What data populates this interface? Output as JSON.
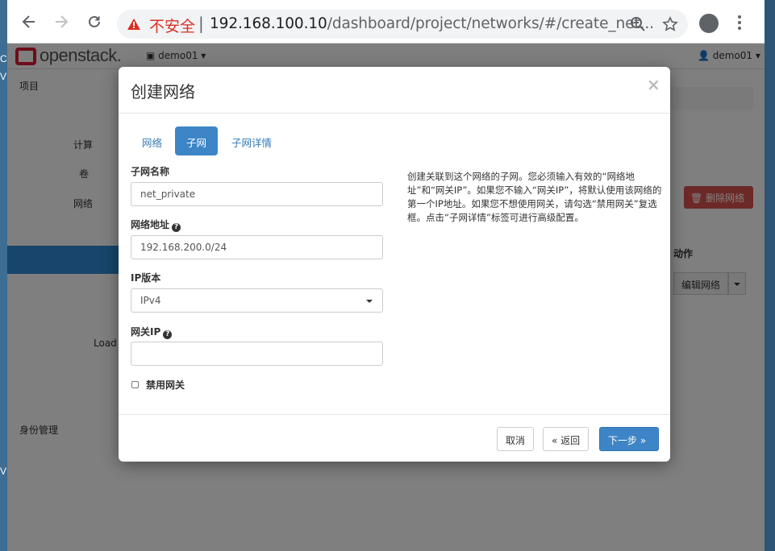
{
  "browser": {
    "security_label": "不安全",
    "url_host": "192.168.100.10",
    "url_path": "/dashboard/project/networks/#/create_net..."
  },
  "openstack": {
    "logo_text": "openstack.",
    "project_menu": "demo01",
    "user_menu": "demo01",
    "sidebar": {
      "project": "项目",
      "compute": "计算",
      "volumes": "卷",
      "network": "网络",
      "load": "Load",
      "identity": "身份管理"
    },
    "delete_network_button": "删除网络",
    "actions_header": "动作",
    "edit_network_button": "编辑网络"
  },
  "desktop_left": {
    "letters": [
      "C",
      "V",
      "V"
    ]
  },
  "modal": {
    "title": "创建网络",
    "close": "×",
    "tabs": [
      {
        "label": "网络",
        "active": false
      },
      {
        "label": "子网",
        "active": true
      },
      {
        "label": "子网详情",
        "active": false
      }
    ],
    "fields": {
      "subnet_name": {
        "label": "子网名称",
        "value": "net_private"
      },
      "network_address": {
        "label": "网络地址",
        "value": "192.168.200.0/24"
      },
      "ip_version": {
        "label": "IP版本",
        "value": "IPv4"
      },
      "gateway_ip": {
        "label": "网关IP",
        "value": ""
      },
      "disable_gateway": {
        "label": "禁用网关",
        "checked": false
      }
    },
    "help_text": "创建关联到这个网络的子网。您必须输入有效的“网络地址”和“网关IP”。如果您不输入“网关IP”，将默认使用该网络的第一个IP地址。如果您不想使用网关，请勾选“禁用网关”复选框。点击“子网详情”标签可进行高级配置。",
    "buttons": {
      "cancel": "取消",
      "back": "« 返回",
      "next": "下一步 »"
    }
  }
}
